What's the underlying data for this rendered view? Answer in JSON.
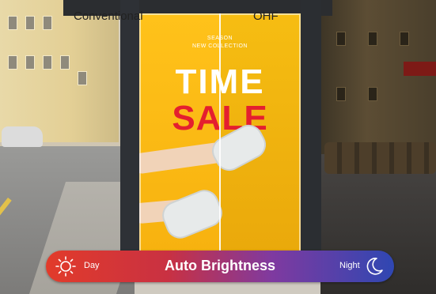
{
  "comparison": {
    "left_label": "Conventional",
    "right_label": "OHF"
  },
  "poster": {
    "season_line1": "SEASON",
    "season_line2": "NEW COLLECTION",
    "headline1": "TIME",
    "headline2": "SALE"
  },
  "brightness_bar": {
    "left_label": "Day",
    "title": "Auto Brightness",
    "right_label": "Night",
    "left_icon": "sun-icon",
    "right_icon": "moon-icon"
  },
  "colors": {
    "poster_yellow": "#ffc21a",
    "sale_red": "#e41f2f",
    "bar_start": "#e23b2a",
    "bar_end": "#2f47b2"
  }
}
